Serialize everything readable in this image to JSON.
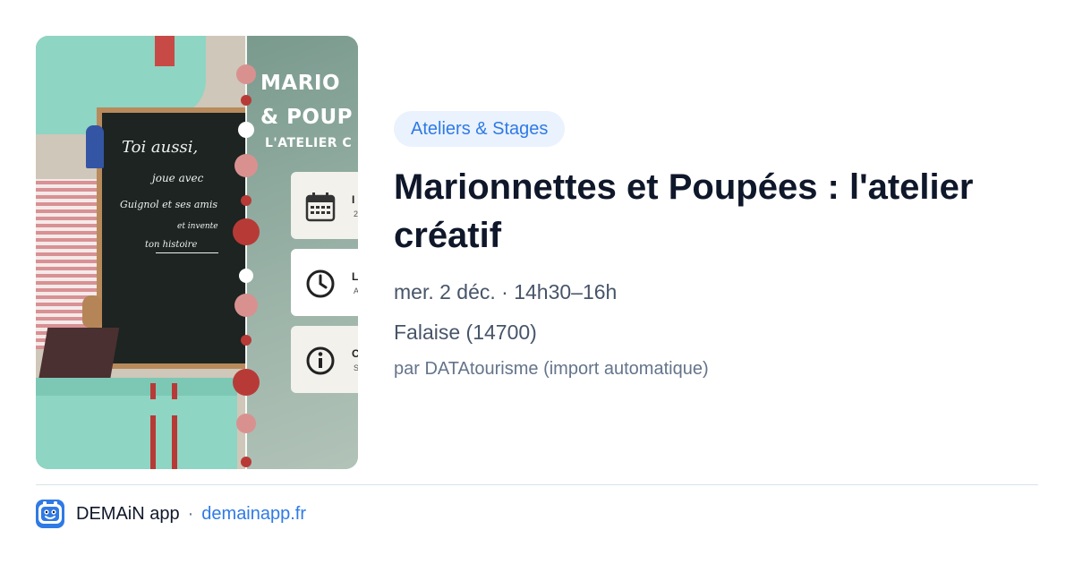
{
  "card": {
    "category": "Ateliers & Stages",
    "title": "Marionnettes et Poupées : l'atelier créatif",
    "date_time": "mer. 2 déc. · 14h30–16h",
    "location": "Falaise (14700)",
    "author": "par DATAtourisme (import automatique)"
  },
  "poster": {
    "title_lines": [
      "MARIO",
      "& POUP",
      "L'ATELIER C"
    ],
    "info_cards": [
      {
        "icon": "calendar-icon",
        "text": "I",
        "sub": "2"
      },
      {
        "icon": "clock-icon",
        "text": "L",
        "sub": "A"
      },
      {
        "icon": "info-icon",
        "text": "C",
        "sub": "S"
      }
    ],
    "chalkboard_lines": [
      "Toi aussi,",
      "joue avec",
      "Guignol et ses amis",
      "et invente",
      "ton histoire"
    ]
  },
  "footer": {
    "app_name": "DEMAiN app",
    "separator": "·",
    "domain": "demainapp.fr"
  },
  "colors": {
    "accent": "#2f7ae5",
    "tag_bg": "#eaf2fd",
    "title": "#0f172a",
    "meta": "#475569",
    "muted": "#64748b",
    "poster_mint": "#8ed5c3",
    "poster_red": "#c84a46"
  }
}
